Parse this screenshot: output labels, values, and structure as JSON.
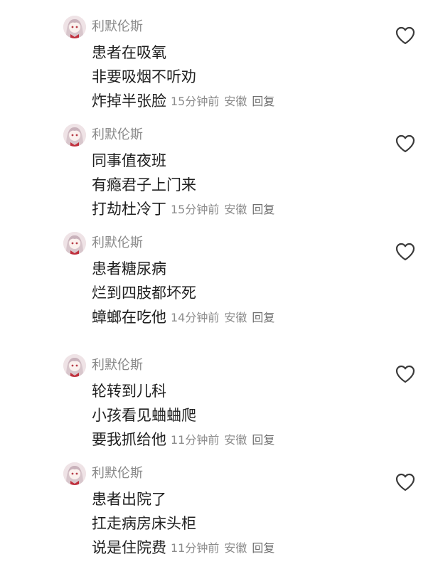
{
  "comments": [
    {
      "username": "利默伦斯",
      "lines": [
        "患者在吸氧",
        "非要吸烟不听劝",
        "炸掉半张脸"
      ],
      "time": "15分钟前",
      "location": "安徽",
      "reply_label": "回复"
    },
    {
      "username": "利默伦斯",
      "lines": [
        "同事值夜班",
        "有瘾君子上门来",
        "打劫杜冷丁"
      ],
      "time": "15分钟前",
      "location": "安徽",
      "reply_label": "回复"
    },
    {
      "username": "利默伦斯",
      "lines": [
        "患者糖尿病",
        "烂到四肢都坏死",
        "蟑螂在吃他"
      ],
      "time": "14分钟前",
      "location": "安徽",
      "reply_label": "回复"
    },
    {
      "username": "利默伦斯",
      "lines": [
        "轮转到儿科",
        "小孩看见蛐蛐爬",
        "要我抓给他"
      ],
      "time": "11分钟前",
      "location": "安徽",
      "reply_label": "回复"
    },
    {
      "username": "利默伦斯",
      "lines": [
        "患者出院了",
        "扛走病房床头柜",
        "说是住院费"
      ],
      "time": "11分钟前",
      "location": "安徽",
      "reply_label": "回复"
    }
  ],
  "colors": {
    "username": "#8a8a8a",
    "text": "#1f1f1f",
    "meta": "#8c8c8c",
    "like_icon": "#3a3a3a"
  },
  "icons": {
    "like": "heart-outline-icon",
    "avatar": "anime-girl-avatar"
  }
}
